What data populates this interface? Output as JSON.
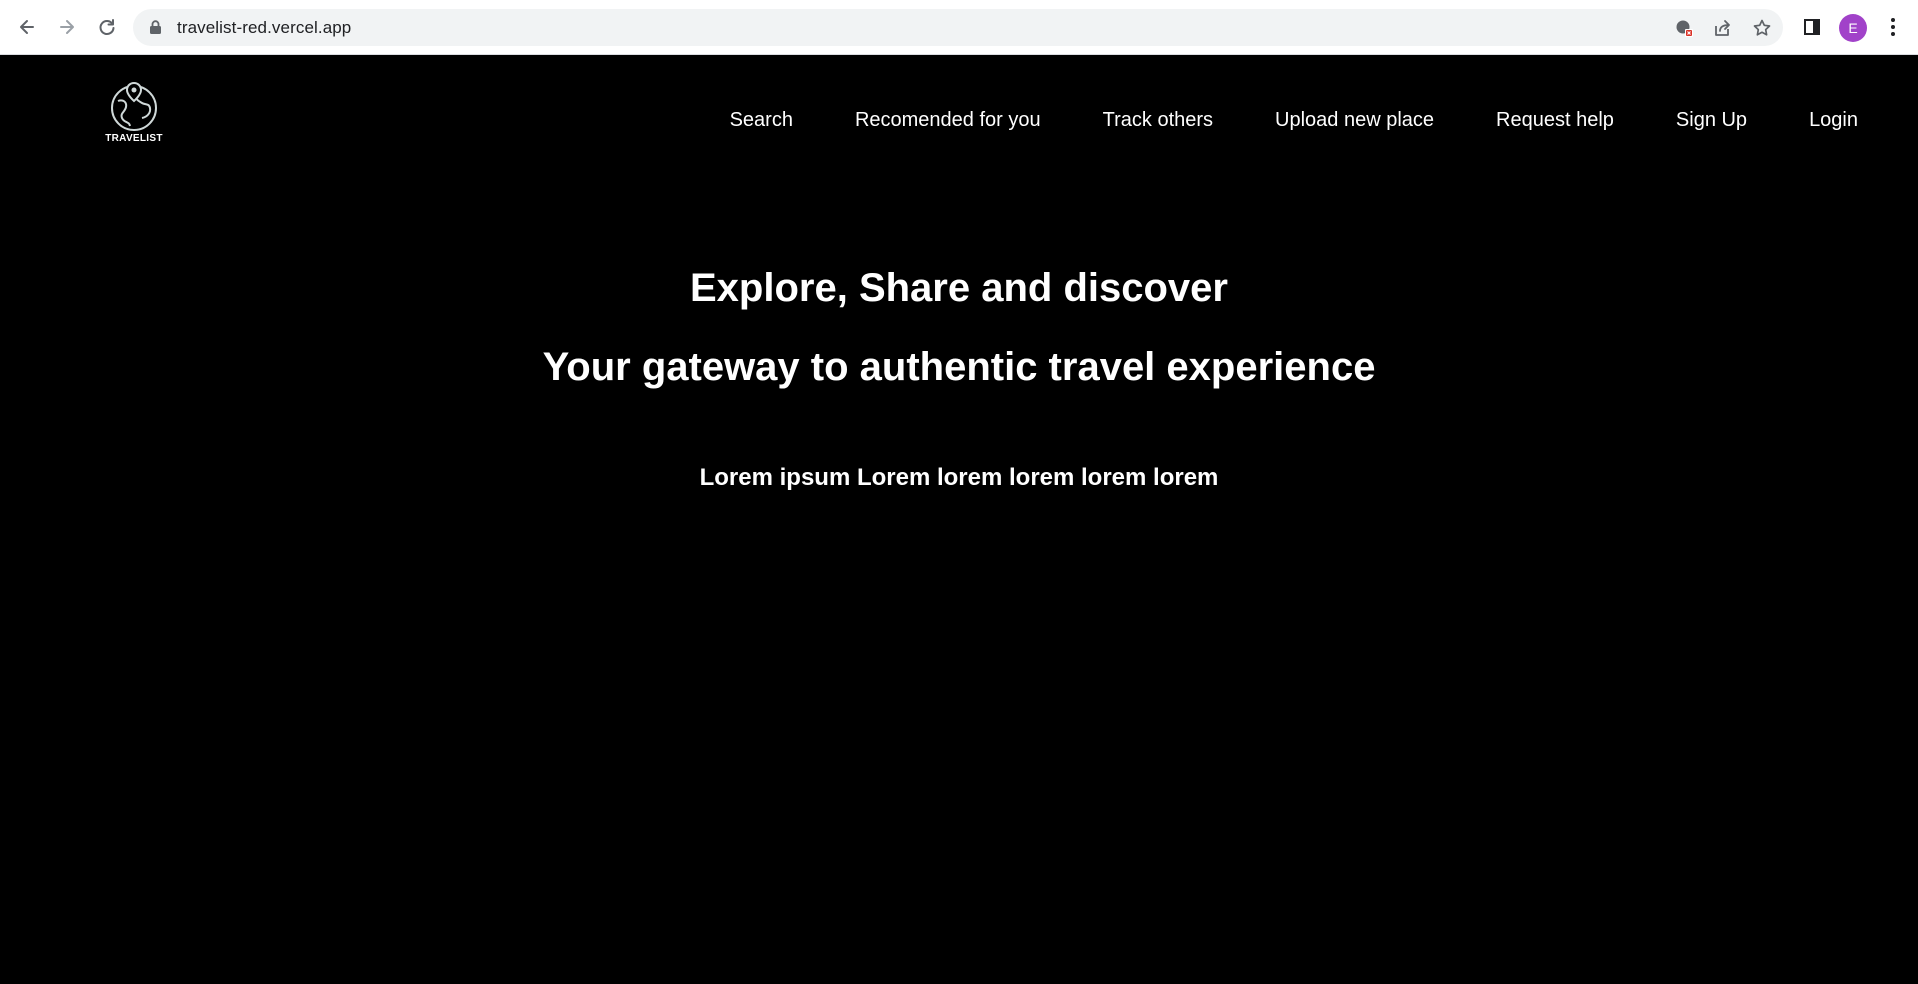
{
  "browser": {
    "url": "travelist-red.vercel.app",
    "profile_initial": "E",
    "profile_color": "#a142c9",
    "icons": [
      "back-icon",
      "forward-icon",
      "reload-icon",
      "lock-icon",
      "blocked-icon",
      "share-icon",
      "bookmark-star-icon",
      "side-panel-icon",
      "menu-icon"
    ]
  },
  "site": {
    "logo_text": "TRAVELIST",
    "nav": {
      "items": [
        {
          "label": "Search"
        },
        {
          "label": "Recomended for you"
        },
        {
          "label": "Track others"
        },
        {
          "label": "Upload new place"
        },
        {
          "label": "Request help"
        },
        {
          "label": "Sign Up"
        },
        {
          "label": "Login"
        }
      ]
    },
    "hero": {
      "title": "Explore, Share and discover",
      "subtitle": "Your gateway to authentic travel experience",
      "tagline": "Lorem ipsum Lorem lorem lorem lorem lorem"
    },
    "colors": {
      "background": "#000000",
      "text": "#ffffff"
    }
  }
}
